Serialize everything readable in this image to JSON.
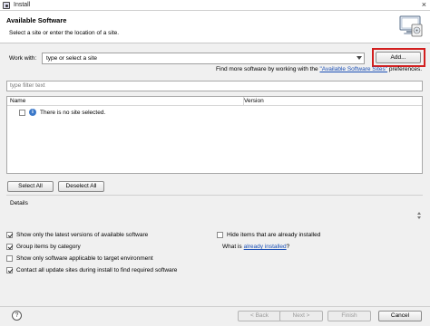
{
  "window": {
    "title": "Install"
  },
  "header": {
    "title": "Available Software",
    "subtitle": "Select a site or enter the location of a site."
  },
  "work_with": {
    "label": "Work with:",
    "value": "type or select a site",
    "add_button": "Add..."
  },
  "more_info": {
    "prefix": "Find more software by working with the ",
    "link": "\"Available Software Sites\"",
    "suffix": " preferences."
  },
  "filter": {
    "placeholder": "type filter text"
  },
  "table": {
    "columns": [
      "Name",
      "Version"
    ],
    "message": "There is no site selected."
  },
  "buttons": {
    "select_all": "Select All",
    "deselect_all": "Deselect All"
  },
  "details": {
    "label": "Details"
  },
  "options": {
    "latest_versions": {
      "label": "Show only the latest versions of available software",
      "checked": true
    },
    "group_by_category": {
      "label": "Group items by category",
      "checked": true
    },
    "target_env": {
      "label": "Show only software applicable to target environment",
      "checked": false
    },
    "contact_sites": {
      "label": "Contact all update sites during install to find required software",
      "checked": true
    },
    "hide_installed": {
      "label": "Hide items that are already installed",
      "checked": false
    },
    "what_is_prefix": "What is ",
    "what_is_link": "already installed",
    "what_is_suffix": "?"
  },
  "footer": {
    "back": "< Back",
    "next": "Next >",
    "finish": "Finish",
    "cancel": "Cancel"
  }
}
